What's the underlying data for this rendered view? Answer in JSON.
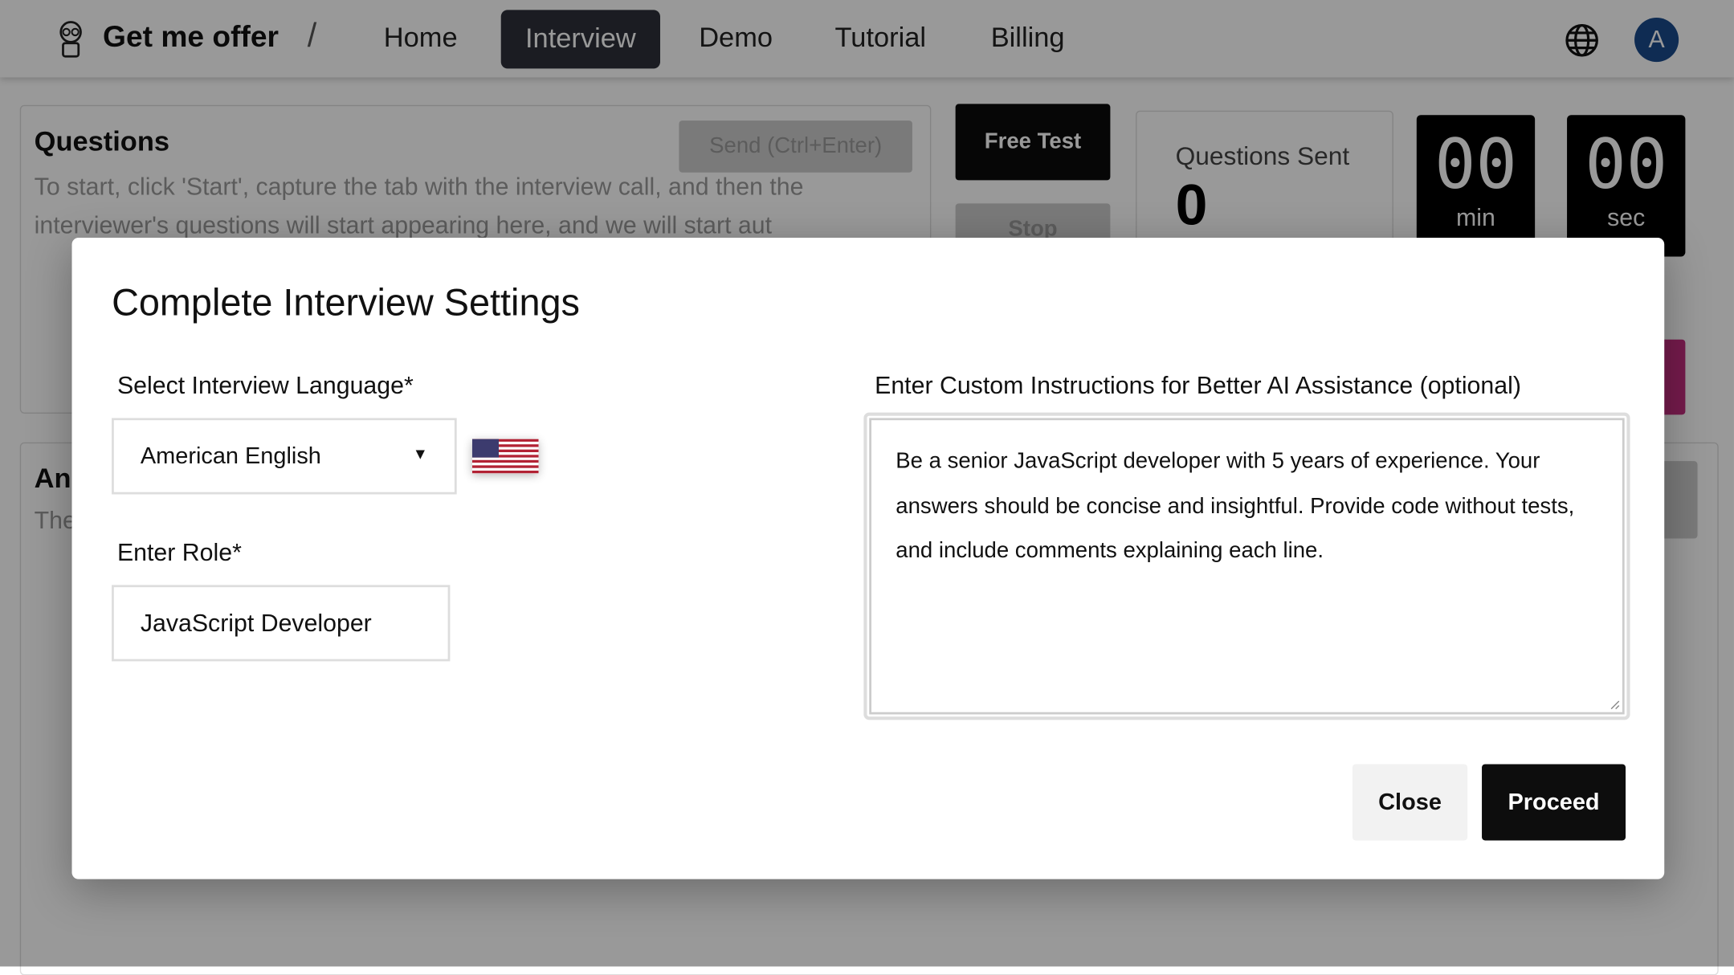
{
  "header": {
    "brand": "Get me offer",
    "separator": "/",
    "nav": [
      {
        "label": "Home"
      },
      {
        "label": "Interview",
        "active": true
      },
      {
        "label": "Demo"
      },
      {
        "label": "Tutorial"
      },
      {
        "label": "Billing"
      }
    ],
    "avatar_initial": "A",
    "icons": [
      "robot-logo-icon",
      "globe-icon"
    ],
    "accent": "#1a4a8a"
  },
  "questions": {
    "title": "Questions",
    "send_label": "Send (Ctrl+Enter)",
    "hint": "To start, click 'Start', capture the tab with the interview call, and then the interviewer's questions will start appearing here, and we will start aut"
  },
  "controls": {
    "free_test": "Free Test",
    "stop": "Stop"
  },
  "stats": {
    "questions_sent_label": "Questions Sent",
    "questions_sent": "0",
    "minutes": "00",
    "minutes_unit": "min",
    "seconds": "00",
    "seconds_unit": "sec"
  },
  "answers": {
    "title": "An",
    "text": "The"
  },
  "modal": {
    "title": "Complete Interview Settings",
    "language_label": "Select Interview Language*",
    "language_value": "American English",
    "role_label": "Enter Role*",
    "role_value": "JavaScript Developer",
    "instructions_label": "Enter Custom Instructions for Better AI Assistance (optional)",
    "instructions_value": "Be a senior JavaScript developer with 5 years of experience. Your answers should be concise and insightful. Provide code without tests, and include comments explaining each line.",
    "close_label": "Close",
    "proceed_label": "Proceed"
  }
}
